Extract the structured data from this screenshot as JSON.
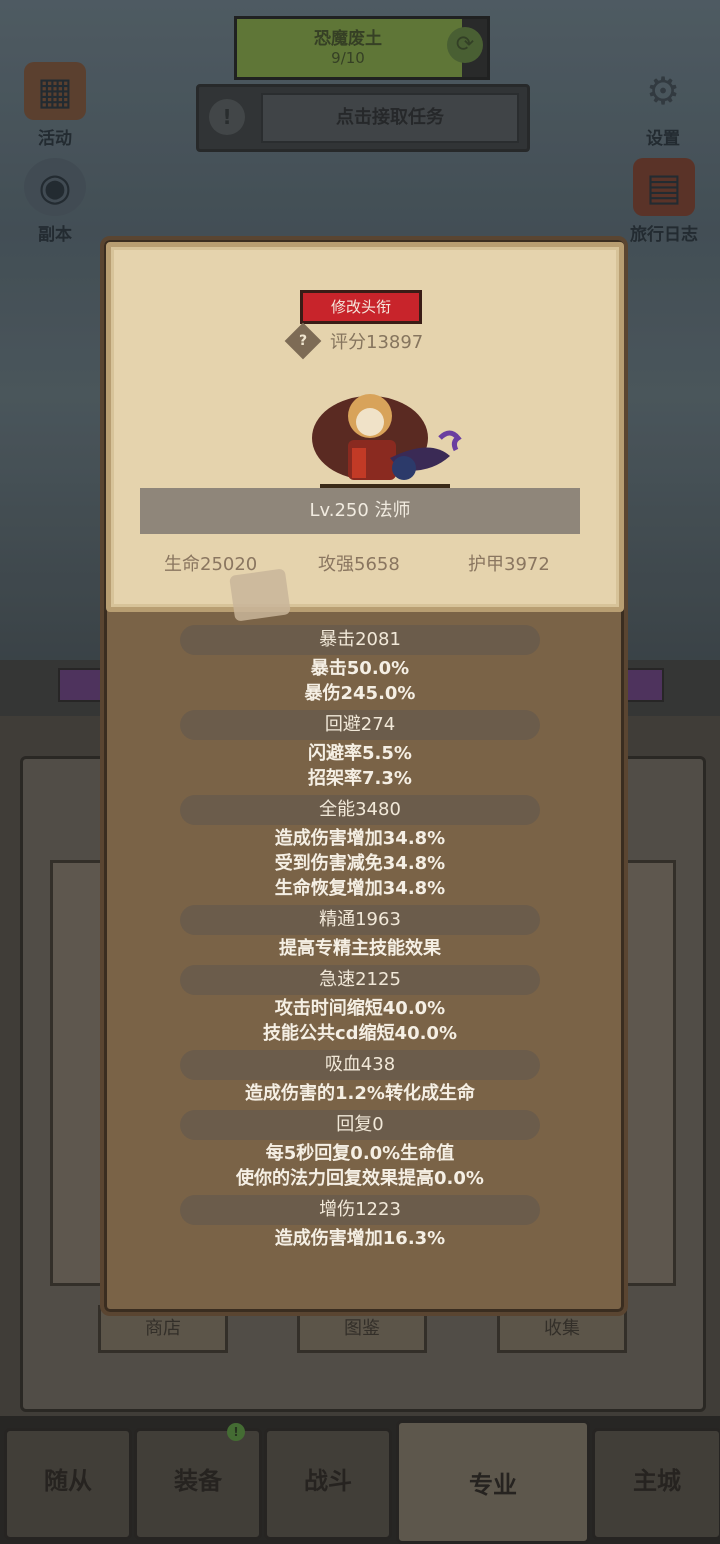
{
  "top_status": {
    "title": "恐魔废土",
    "progress_text": "9/10",
    "progress": 0.9
  },
  "quest": {
    "button_label": "点击接取任务"
  },
  "side_icons": {
    "activity": "活动",
    "dungeon": "副本",
    "settings": "设置",
    "travel_log": "旅行日志"
  },
  "back_tabs": [
    "商店",
    "图鉴",
    "收集"
  ],
  "bottom_nav": [
    "随从",
    "装备",
    "战斗",
    "专业",
    "主城"
  ],
  "profile": {
    "edit_title_label": "修改头衔",
    "score": "评分13897",
    "level_class": "Lv.250 法师",
    "hp": "生命25020",
    "attack": "攻强5658",
    "armor": "护甲3972"
  },
  "stats": [
    {
      "header": "暴击2081",
      "lines": [
        "暴击50.0%",
        "暴伤245.0%"
      ]
    },
    {
      "header": "回避274",
      "lines": [
        "闪避率5.5%",
        "招架率7.3%"
      ]
    },
    {
      "header": "全能3480",
      "lines": [
        "造成伤害增加34.8%",
        "受到伤害减免34.8%",
        "生命恢复增加34.8%"
      ]
    },
    {
      "header": "精通1963",
      "lines": [
        "提高专精主技能效果"
      ]
    },
    {
      "header": "急速2125",
      "lines": [
        "攻击时间缩短40.0%",
        "技能公共cd缩短40.0%"
      ]
    },
    {
      "header": "吸血438",
      "lines": [
        "造成伤害的1.2%转化成生命"
      ]
    },
    {
      "header": "回复0",
      "lines": [
        "每5秒回复0.0%生命值",
        "使你的法力回复效果提高0.0%"
      ]
    },
    {
      "header": "增伤1223",
      "lines": [
        "造成伤害增加16.3%"
      ]
    }
  ]
}
